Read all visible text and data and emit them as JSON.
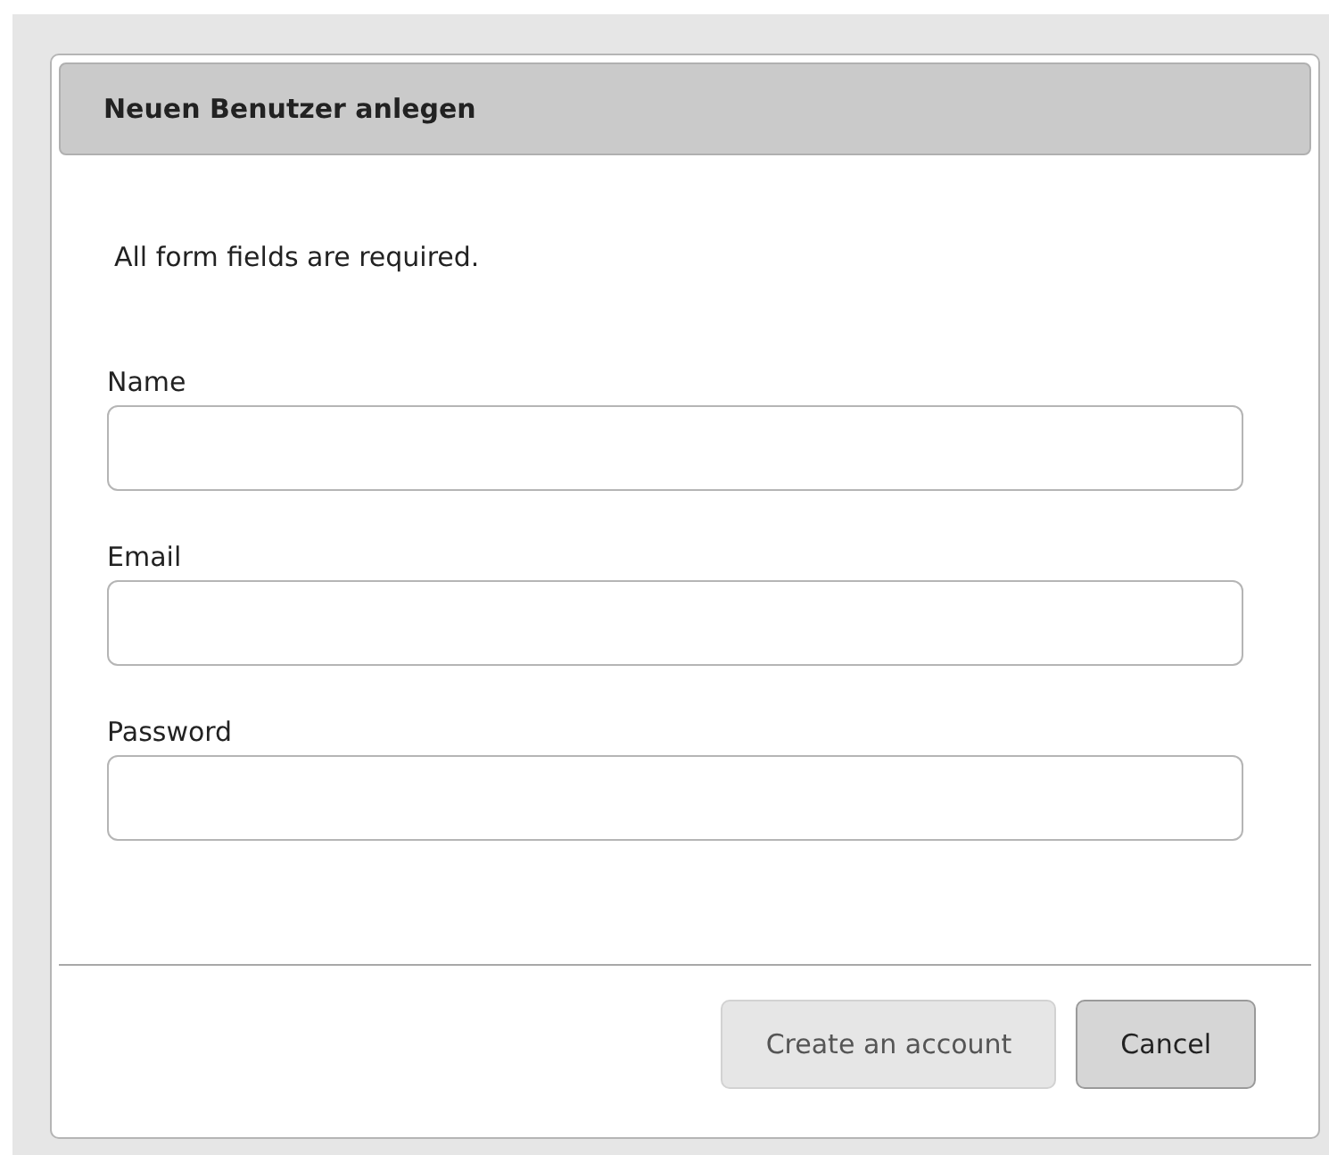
{
  "dialog": {
    "title": "Neuen Benutzer anlegen",
    "note": "All form fields are required."
  },
  "fields": [
    {
      "label": "Name"
    },
    {
      "label": "Email"
    },
    {
      "label": "Password"
    }
  ],
  "buttons": [
    {
      "label": "Create an account",
      "disabled": true
    },
    {
      "label": "Cancel",
      "disabled": false
    }
  ]
}
